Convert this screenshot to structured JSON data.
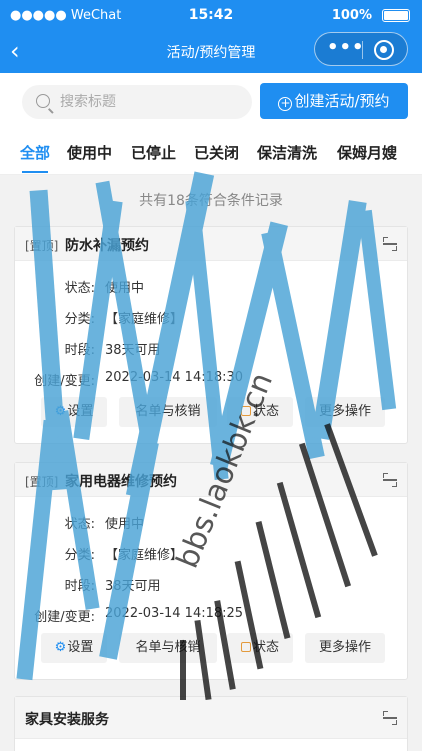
{
  "status_bar": {
    "carrier": "●●●●● WeChat",
    "time": "15:42",
    "battery": "100%"
  },
  "nav": {
    "back": "‹",
    "title": "活动/预约管理"
  },
  "search": {
    "placeholder": "搜索标题",
    "create_label": "创建活动/预约"
  },
  "tabs": [
    "全部",
    "使用中",
    "已停止",
    "已关闭",
    "保洁清洗",
    "保姆月嫂"
  ],
  "summary": "共有18条符合条件记录",
  "labels": {
    "status": "状态:",
    "category": "分类:",
    "period": "时段:",
    "created": "创建/变更:"
  },
  "actions": {
    "settings": "设置",
    "list": "名单与核销",
    "status": "状态",
    "more": "更多操作"
  },
  "cards": [
    {
      "pin": "[置顶]",
      "name": "防水补漏预约",
      "status": "使用中",
      "category": "【家庭维修】",
      "period": "38天可用",
      "created": "2022-03-14 14:18:30"
    },
    {
      "pin": "[置顶]",
      "name": "家用电器维修预约",
      "status": "使用中",
      "category": "【家庭维修】",
      "period": "38天可用",
      "created": "2022-03-14 14:18:25"
    },
    {
      "pin": "",
      "name": "家具安装服务"
    }
  ],
  "watermark": "bbs.laokbk.cn",
  "colors": {
    "accent": "#1f8ef1",
    "watermark": "#4aa3d6"
  }
}
